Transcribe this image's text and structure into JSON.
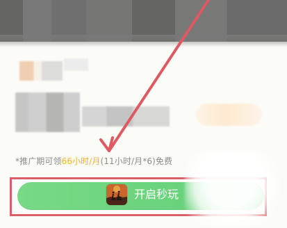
{
  "colors": {
    "annotation": "#d85f68",
    "button": "#6fd57f",
    "highlight": "#ecb32a",
    "note_text": "#8b8b8b"
  },
  "notice": {
    "prefix": "*推广期可领",
    "highlight": "66小时/月",
    "suffix": "(11小时/月*6)免费"
  },
  "cta": {
    "label": "开启秒玩"
  },
  "icons": {
    "game": "game-icon",
    "arrow": "red-arrow-icon"
  }
}
